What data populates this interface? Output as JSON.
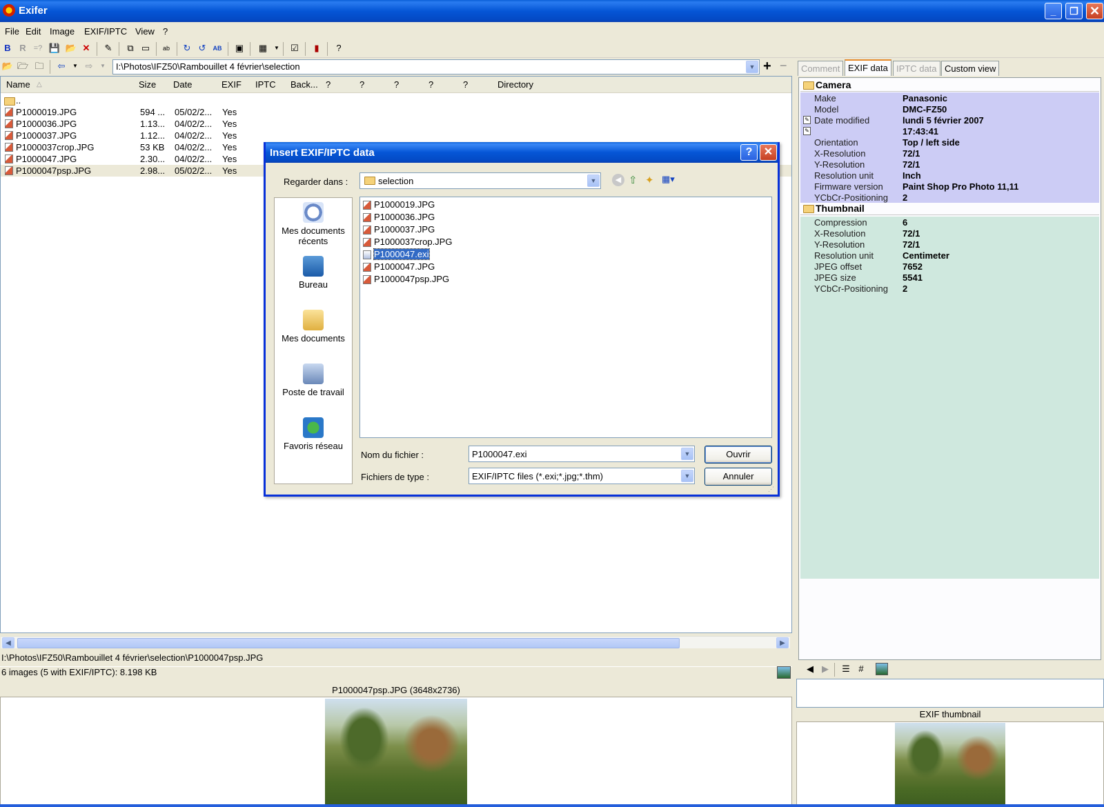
{
  "window": {
    "title": "Exifer"
  },
  "menu": [
    "File",
    "Edit",
    "Image",
    "EXIF/IPTC",
    "View",
    "?"
  ],
  "path_combo": {
    "value": "I:\\Photos\\IFZ50\\Rambouillet 4 février\\selection"
  },
  "file_list": {
    "columns": [
      "Name",
      "Size",
      "Date",
      "EXIF",
      "IPTC",
      "Back...",
      "?",
      "?",
      "?",
      "?",
      "?",
      "Directory"
    ],
    "parent": "..",
    "rows": [
      {
        "name": "P1000019.JPG",
        "size": "594 ...",
        "date": "05/02/2...",
        "exif": "Yes"
      },
      {
        "name": "P1000036.JPG",
        "size": "1.13...",
        "date": "04/02/2...",
        "exif": "Yes"
      },
      {
        "name": "P1000037.JPG",
        "size": "1.12...",
        "date": "04/02/2...",
        "exif": "Yes"
      },
      {
        "name": "P1000037crop.JPG",
        "size": "53 KB",
        "date": "04/02/2...",
        "exif": "Yes"
      },
      {
        "name": "P1000047.JPG",
        "size": "2.30...",
        "date": "04/02/2...",
        "exif": "Yes"
      },
      {
        "name": "P1000047psp.JPG",
        "size": "2.98...",
        "date": "05/02/2...",
        "exif": "Yes"
      }
    ]
  },
  "status": {
    "path": "I:\\Photos\\IFZ50\\Rambouillet 4 février\\selection\\P1000047psp.JPG",
    "count": "6 images (5 with EXIF/IPTC): 8.198 KB"
  },
  "preview": {
    "title": "P1000047psp.JPG (3648x2736)"
  },
  "right_panel": {
    "tabs": [
      "Comment",
      "EXIF data",
      "IPTC data",
      "Custom view"
    ],
    "camera_group": "Camera",
    "camera": [
      {
        "k": "Make",
        "v": "Panasonic"
      },
      {
        "k": "Model",
        "v": "DMC-FZ50"
      },
      {
        "k": "Date modified",
        "v": "lundi 5 février 2007"
      },
      {
        "k": "",
        "v": "17:43:41"
      },
      {
        "k": "Orientation",
        "v": "Top / left side"
      },
      {
        "k": "X-Resolution",
        "v": "72/1"
      },
      {
        "k": "Y-Resolution",
        "v": "72/1"
      },
      {
        "k": "Resolution unit",
        "v": "Inch"
      },
      {
        "k": "Firmware version",
        "v": "Paint Shop Pro Photo 11,11"
      },
      {
        "k": "YCbCr-Positioning",
        "v": "2"
      }
    ],
    "thumbnail_group": "Thumbnail",
    "thumbnail": [
      {
        "k": "Compression",
        "v": "6"
      },
      {
        "k": "X-Resolution",
        "v": "72/1"
      },
      {
        "k": "Y-Resolution",
        "v": "72/1"
      },
      {
        "k": "Resolution unit",
        "v": "Centimeter"
      },
      {
        "k": "JPEG offset",
        "v": "7652"
      },
      {
        "k": "JPEG size",
        "v": "5541"
      },
      {
        "k": "YCbCr-Positioning",
        "v": "2"
      }
    ],
    "thumb_title": "EXIF thumbnail"
  },
  "dialog": {
    "title": "Insert EXIF/IPTC data",
    "look_in_label": "Regarder dans :",
    "look_in_value": "selection",
    "places": [
      "Mes documents récents",
      "Bureau",
      "Mes documents",
      "Poste de travail",
      "Favoris réseau"
    ],
    "files": [
      "P1000019.JPG",
      "P1000036.JPG",
      "P1000037.JPG",
      "P1000037crop.JPG",
      "P1000047.exi",
      "P1000047.JPG",
      "P1000047psp.JPG"
    ],
    "filename_label": "Nom du fichier :",
    "filename_value": "P1000047.exi",
    "filetype_label": "Fichiers de type :",
    "filetype_value": "EXIF/IPTC files (*.exi;*.jpg;*.thm)",
    "open_label": "Ouvrir",
    "cancel_label": "Annuler"
  },
  "icons": {
    "title_help": "?",
    "title_close": "✕"
  }
}
